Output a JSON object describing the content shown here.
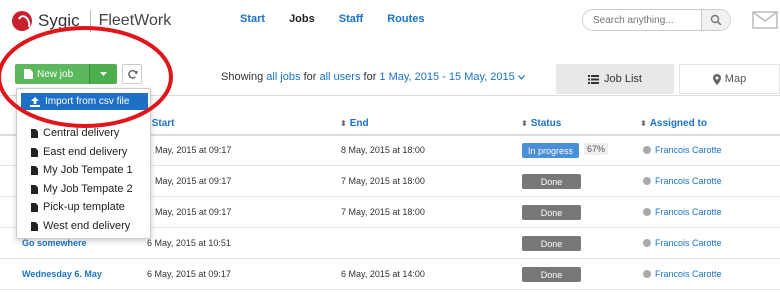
{
  "header": {
    "brand": "Sygic",
    "product": "FleetWork",
    "nav": [
      {
        "label": "Start",
        "active": false
      },
      {
        "label": "Jobs",
        "active": true
      },
      {
        "label": "Staff",
        "active": false
      },
      {
        "label": "Routes",
        "active": false
      }
    ],
    "search_placeholder": "Search anything...",
    "icons": {
      "search": "search-icon",
      "mail": "mail-icon"
    }
  },
  "toolbar": {
    "new_job_label": "New job",
    "showing": {
      "prefix": "Showing",
      "jobs_link": "all jobs",
      "for": "for",
      "users_link": "all users",
      "for2": "for",
      "range_link": "1 May, 2015 - 15 May, 2015"
    },
    "tab_job_list": "Job List",
    "tab_map": "Map"
  },
  "dropdown": {
    "import_label": "Import from csv file",
    "items": [
      "Central delivery",
      "East end delivery",
      "My Job Tempate 1",
      "My Job Tempate 2",
      "Pick-up template",
      "West end delivery"
    ]
  },
  "table": {
    "columns": {
      "start": "Start",
      "end": "End",
      "status": "Status",
      "assigned": "Assigned to"
    },
    "rows": [
      {
        "name": "",
        "start": "May, 2015 at 09:17",
        "end": "8 May, 2015 at 18:00",
        "status": "In progress",
        "pct": "67%",
        "assigned": "Francois Carotte"
      },
      {
        "name": "",
        "start": "May, 2015 at 09:17",
        "end": "7 May, 2015 at 18:00",
        "status": "Done",
        "pct": "",
        "assigned": "Francois Carotte"
      },
      {
        "name": "",
        "start": "May, 2015 at 09:17",
        "end": "7 May, 2015 at 18:00",
        "status": "Done",
        "pct": "",
        "assigned": "Francois Carotte"
      },
      {
        "name": "Go somewhere",
        "start": "6 May, 2015 at 10:51",
        "end": "",
        "status": "Done",
        "pct": "",
        "assigned": "Francois Carotte"
      },
      {
        "name": "Wednesday 6. May",
        "start": "6 May, 2015 at 09:17",
        "end": "6 May, 2015 at 14:00",
        "status": "Done",
        "pct": "",
        "assigned": "Francois Carotte"
      }
    ]
  },
  "colors": {
    "accent": "#1a73c9",
    "green": "#5cb85c",
    "highlight_ring": "#e0161b"
  }
}
